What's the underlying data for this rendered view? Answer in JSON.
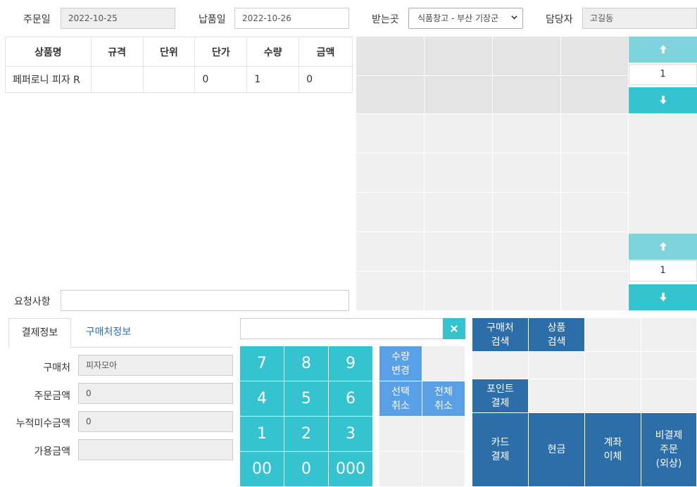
{
  "header": {
    "order_date_label": "주문일",
    "order_date": "2022-10-25",
    "delivery_date_label": "납품일",
    "delivery_date": "2022-10-26",
    "receiver_label": "받는곳",
    "receiver_selected": "식품창고 - 부산 기장군",
    "manager_label": "담당자",
    "manager": "고길동"
  },
  "order_table": {
    "columns": [
      "상품명",
      "규격",
      "단위",
      "단가",
      "수량",
      "금액"
    ],
    "rows": [
      [
        "페퍼로니 피자 R",
        "",
        "",
        "0",
        "1",
        "0"
      ]
    ]
  },
  "request": {
    "label": "요청사항",
    "value": ""
  },
  "product_pager_top": {
    "page": "1"
  },
  "product_pager_bottom": {
    "page": "1"
  },
  "tabs": [
    {
      "label": "결제정보",
      "active": true
    },
    {
      "label": "구매처정보",
      "active": false
    }
  ],
  "payment": {
    "buyer_label": "구매처",
    "buyer": "피자모아",
    "order_amount_label": "주문금액",
    "order_amount": "0",
    "unpaid_label": "누적미수금액",
    "unpaid": "0",
    "available_label": "가용금액",
    "available": ""
  },
  "keypad": {
    "keys": [
      "7",
      "8",
      "9",
      "4",
      "5",
      "6",
      "1",
      "2",
      "3",
      "00",
      "0",
      "000"
    ],
    "input_value": ""
  },
  "functions": {
    "qty_change": "수량\n변경",
    "select_cancel": "선택\n취소",
    "all_cancel": "전체\n취소"
  },
  "actions": {
    "buyer_search": "구매처\n검색",
    "product_search": "상품\n검색",
    "point_pay": "포인트\n결제",
    "card_pay": "카드\n결제",
    "cash": "현금",
    "transfer": "계좌\n이체",
    "credit_order": "비결제\n주문\n(외상)"
  },
  "colors": {
    "keypad": "#36c3d0",
    "function_blue": "#5aa0e6",
    "action_blue": "#2d6ea8",
    "tab_link": "#2a6fb5"
  }
}
